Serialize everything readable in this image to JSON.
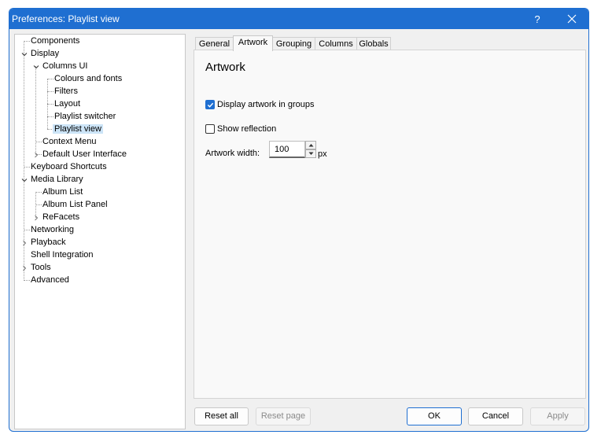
{
  "window": {
    "title": "Preferences: Playlist view",
    "help_label": "?"
  },
  "tree": {
    "items": [
      {
        "label": "Components"
      },
      {
        "label": "Display"
      },
      {
        "label": "Columns UI"
      },
      {
        "label": "Colours and fonts"
      },
      {
        "label": "Filters"
      },
      {
        "label": "Layout"
      },
      {
        "label": "Playlist switcher"
      },
      {
        "label": "Playlist view"
      },
      {
        "label": "Context Menu"
      },
      {
        "label": "Default User Interface"
      },
      {
        "label": "Keyboard Shortcuts"
      },
      {
        "label": "Media Library"
      },
      {
        "label": "Album List"
      },
      {
        "label": "Album List Panel"
      },
      {
        "label": "ReFacets"
      },
      {
        "label": "Networking"
      },
      {
        "label": "Playback"
      },
      {
        "label": "Shell Integration"
      },
      {
        "label": "Tools"
      },
      {
        "label": "Advanced"
      }
    ],
    "selected": "Playlist view"
  },
  "tabs": [
    {
      "label": "General"
    },
    {
      "label": "Artwork"
    },
    {
      "label": "Grouping"
    },
    {
      "label": "Columns"
    },
    {
      "label": "Globals"
    }
  ],
  "active_tab": "Artwork",
  "panel": {
    "title": "Artwork",
    "display_artwork": {
      "label": "Display artwork in groups",
      "checked": true
    },
    "show_reflection": {
      "label": "Show reflection",
      "checked": false
    },
    "artwork_width": {
      "label": "Artwork width:",
      "value": "100",
      "unit": "px"
    }
  },
  "buttons": {
    "reset_all": "Reset all",
    "reset_page": "Reset page",
    "ok": "OK",
    "cancel": "Cancel",
    "apply": "Apply"
  },
  "colors": {
    "accent": "#1f6fd1",
    "selection": "#cce4f7"
  }
}
